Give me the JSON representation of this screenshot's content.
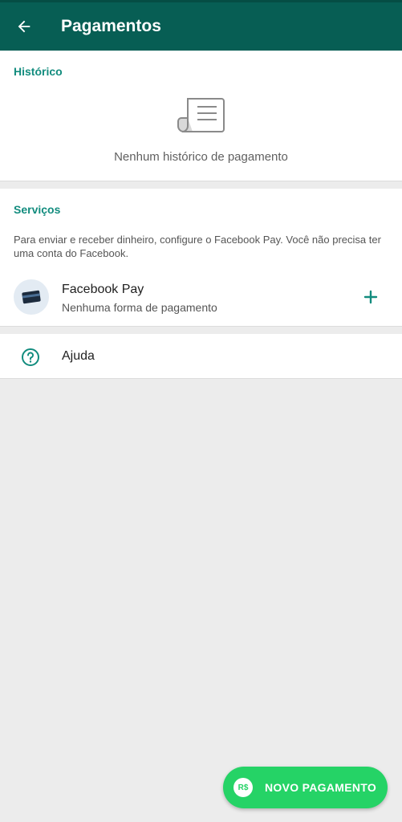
{
  "appbar": {
    "title": "Pagamentos",
    "back_icon": "arrow-left-icon",
    "background_color": "#075e54"
  },
  "history": {
    "header": "Histórico",
    "empty_icon": "receipt-icon",
    "empty_text": "Nenhum histórico de pagamento"
  },
  "services": {
    "header": "Serviços",
    "description": "Para enviar e receber dinheiro, configure o Facebook Pay. Você não precisa ter uma conta do Facebook.",
    "items": [
      {
        "icon": "credit-card-icon",
        "title": "Facebook Pay",
        "subtitle": "Nenhuma forma de pagamento",
        "action_icon": "plus-icon"
      }
    ]
  },
  "help": {
    "icon": "help-circle-icon",
    "label": "Ajuda"
  },
  "fab": {
    "badge": "R$",
    "label": "NOVO PAGAMENTO",
    "color": "#25d366"
  },
  "colors": {
    "accent": "#128c7e",
    "background": "#ececec"
  }
}
